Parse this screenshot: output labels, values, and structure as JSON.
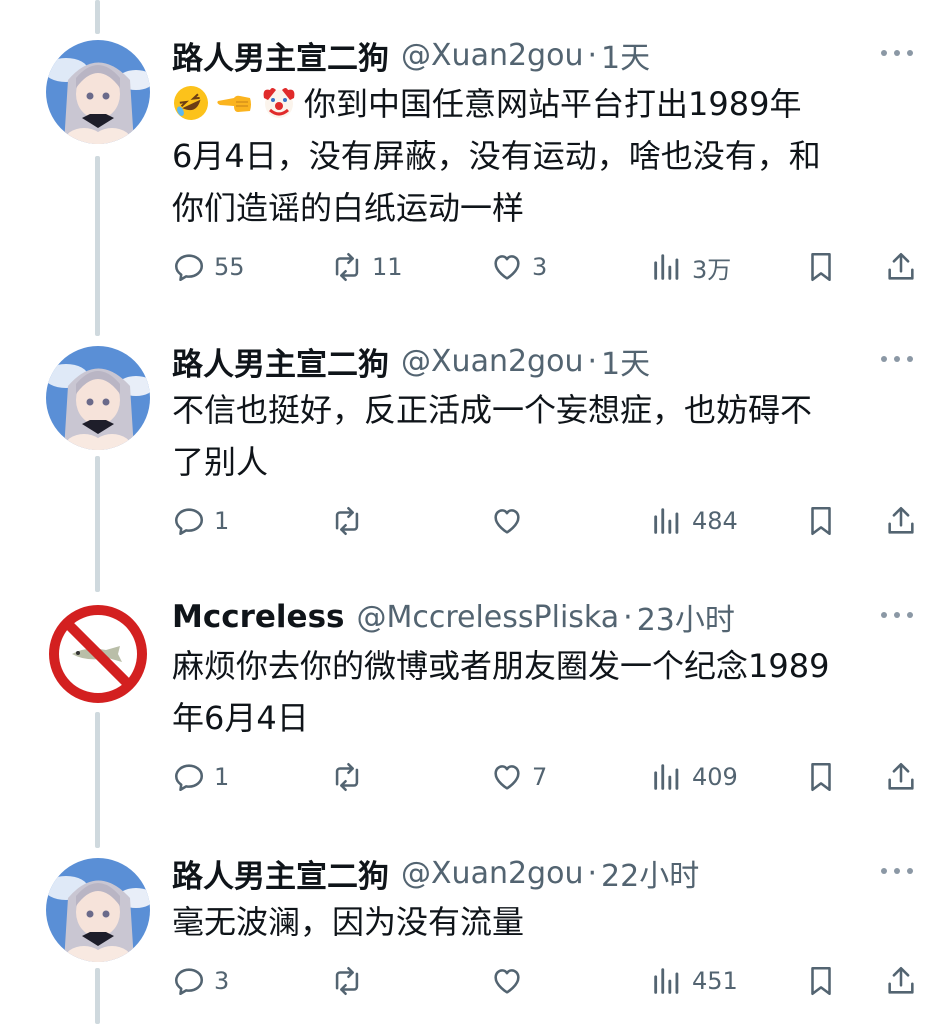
{
  "tweets": [
    {
      "name": "路人男主宣二狗",
      "handle": "@Xuan2gou",
      "dot": "·",
      "time": "1天",
      "text": "你到中国任意网站平台打出1989年\n6月4日，没有屏蔽，没有运动，啥也没有，和\n你们造谣的白纸运动一样",
      "emojis": [
        "rofl-emoji",
        "pointing-left-hand-emoji",
        "clown-face-emoji"
      ],
      "replies": "55",
      "retweets": "11",
      "likes": "3",
      "views": "3万"
    },
    {
      "name": "路人男主宣二狗",
      "handle": "@Xuan2gou",
      "dot": "·",
      "time": "1天",
      "text": "不信也挺好，反正活成一个妄想症，也妨碍不\n了别人",
      "replies": "1",
      "retweets": "",
      "likes": "",
      "views": "484"
    },
    {
      "name": "Mccreless",
      "handle": "@MccrelessPliska",
      "dot": "·",
      "time": "23小时",
      "text": "麻烦你去你的微博或者朋友圈发一个纪念1989\n年6月4日",
      "replies": "1",
      "retweets": "",
      "likes": "7",
      "views": "409"
    },
    {
      "name": "路人男主宣二狗",
      "handle": "@Xuan2gou",
      "dot": "·",
      "time": "22小时",
      "text": "毫无波澜，因为没有流量",
      "replies": "3",
      "retweets": "",
      "likes": "",
      "views": "451"
    }
  ],
  "icons": {
    "reply": "reply-icon",
    "retweet": "retweet-icon",
    "like": "heart-icon",
    "views": "views-chart-icon",
    "bookmark": "bookmark-icon",
    "share": "share-icon",
    "more": "more-options-icon"
  },
  "colors": {
    "text": "#0f1419",
    "secondary": "#536471",
    "thread_line": "#cfd9de",
    "no_sign_red": "#d32020"
  }
}
